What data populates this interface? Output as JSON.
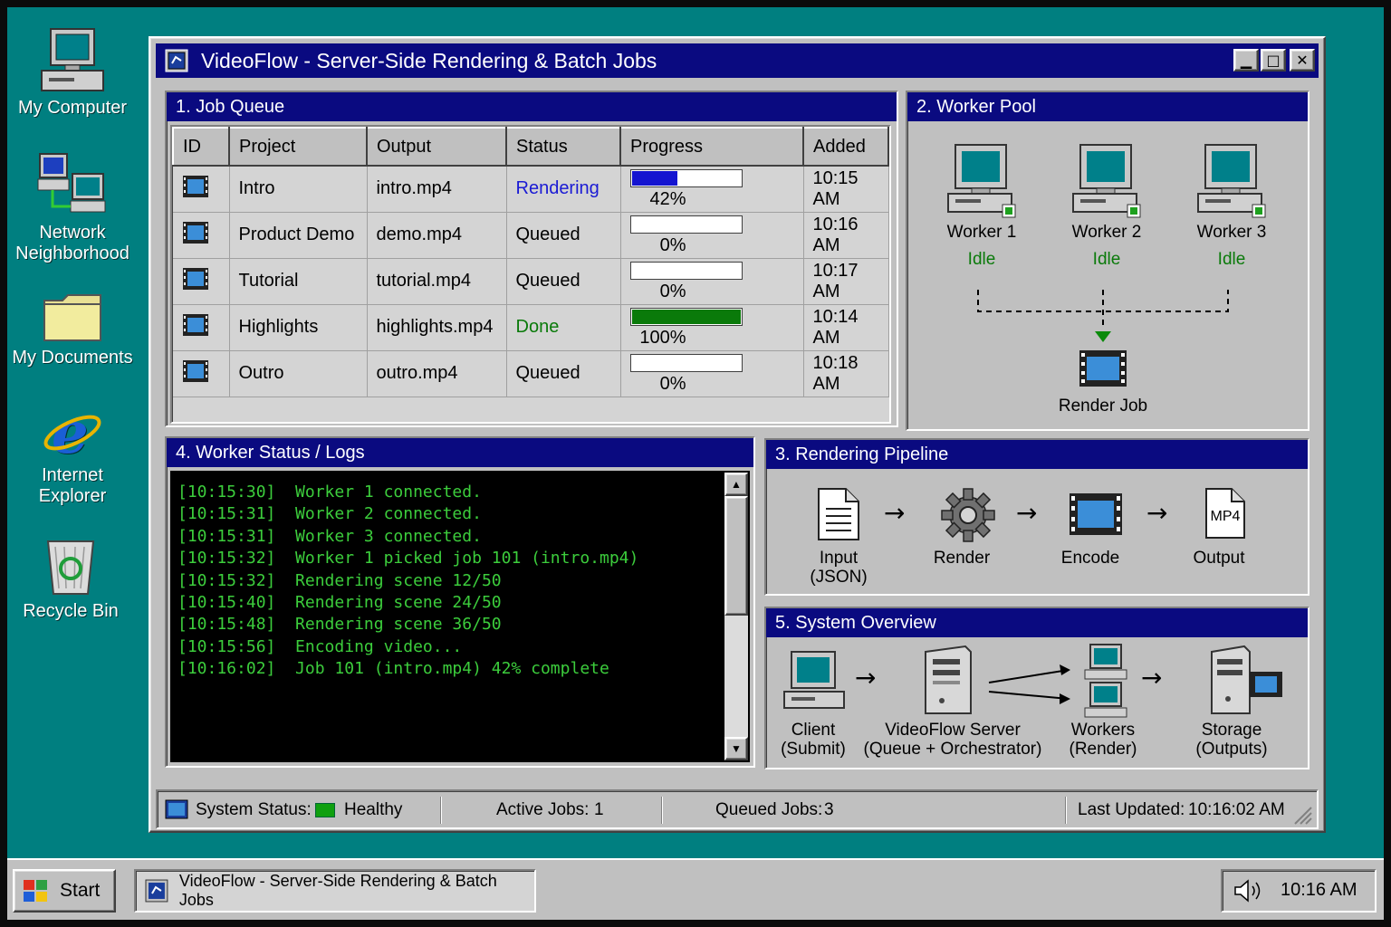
{
  "desktop": {
    "icons": [
      {
        "label": "My Computer",
        "icon": "computer-icon"
      },
      {
        "label": "Network Neighborhood",
        "icon": "network-icon"
      },
      {
        "label": "My Documents",
        "icon": "folder-icon"
      },
      {
        "label": "Internet Explorer",
        "icon": "ie-icon"
      },
      {
        "label": "Recycle Bin",
        "icon": "recycle-bin-icon"
      }
    ]
  },
  "window": {
    "title": "VideoFlow - Server-Side Rendering & Batch Jobs",
    "controls": {
      "minimize": "▁",
      "maximize": "□",
      "close": "✕"
    }
  },
  "job_queue": {
    "title": "1.  Job Queue",
    "columns": [
      "ID",
      "Project",
      "Output",
      "Status",
      "Progress",
      "Added"
    ],
    "rows": [
      {
        "project": "Intro",
        "output": "intro.mp4",
        "status": "Rendering",
        "progress": 42,
        "progress_label": "42%",
        "added": "10:15 AM",
        "status_color": "#1a1ad4",
        "bar_color": "#1414d0"
      },
      {
        "project": "Product Demo",
        "output": "demo.mp4",
        "status": "Queued",
        "progress": 0,
        "progress_label": "0%",
        "added": "10:16 AM",
        "status_color": "#000000",
        "bar_color": "#1414d0"
      },
      {
        "project": "Tutorial",
        "output": "tutorial.mp4",
        "status": "Queued",
        "progress": 0,
        "progress_label": "0%",
        "added": "10:17 AM",
        "status_color": "#000000",
        "bar_color": "#1414d0"
      },
      {
        "project": "Highlights",
        "output": "highlights.mp4",
        "status": "Done",
        "progress": 100,
        "progress_label": "100%",
        "added": "10:14 AM",
        "status_color": "#0a7a0a",
        "bar_color": "#0a7a0a"
      },
      {
        "project": "Outro",
        "output": "outro.mp4",
        "status": "Queued",
        "progress": 0,
        "progress_label": "0%",
        "added": "10:18 AM",
        "status_color": "#000000",
        "bar_color": "#1414d0"
      }
    ]
  },
  "worker_pool": {
    "title": "2. Worker Pool",
    "workers": [
      {
        "name": "Worker 1",
        "state": "Idle"
      },
      {
        "name": "Worker 2",
        "state": "Idle"
      },
      {
        "name": "Worker 3",
        "state": "Idle"
      }
    ],
    "target_label": "Render Job",
    "state_color": "#0a7a0a"
  },
  "logs": {
    "title": "4. Worker Status / Logs",
    "lines": [
      "[10:15:30]  Worker 1 connected.",
      "[10:15:31]  Worker 2 connected.",
      "[10:15:31]  Worker 3 connected.",
      "[10:15:32]  Worker 1 picked job 101 (intro.mp4)",
      "[10:15:32]  Rendering scene 12/50",
      "[10:15:40]  Rendering scene 24/50",
      "[10:15:48]  Rendering scene 36/50",
      "[10:15:56]  Encoding video...",
      "[10:16:02]  Job 101 (intro.mp4) 42% complete"
    ]
  },
  "pipeline": {
    "title": "3. Rendering Pipeline",
    "stages": [
      {
        "label": "Input\n(JSON)",
        "icon": "document-icon"
      },
      {
        "label": "Render",
        "icon": "gear-icon"
      },
      {
        "label": "Encode",
        "icon": "film-icon"
      },
      {
        "label": "Output",
        "icon": "mp4-file-icon",
        "badge": "MP4"
      }
    ],
    "arrow": "→"
  },
  "overview": {
    "title": "5. System Overview",
    "nodes": [
      {
        "label": "Client\n(Submit)",
        "icon": "computer-icon"
      },
      {
        "label": "VideoFlow Server\n(Queue + Orchestrator)",
        "icon": "server-icon"
      },
      {
        "label": "Workers\n(Render)",
        "icon": "workers-icon"
      },
      {
        "label": "Storage\n(Outputs)",
        "icon": "storage-icon"
      }
    ]
  },
  "statusbar": {
    "system_status_label": "System Status:",
    "system_status_value": "Healthy",
    "active_jobs_label": "Active Jobs:",
    "active_jobs_value": "1",
    "queued_jobs_label": "Queued Jobs:",
    "queued_jobs_value": "3",
    "last_updated_label": "Last Updated:",
    "last_updated_value": "10:16:02 AM",
    "healthy_color": "#0fa00f"
  },
  "taskbar": {
    "start_label": "Start",
    "task_label": "VideoFlow - Server-Side Rendering & Batch Jobs",
    "clock": "10:16 AM",
    "tray_icon": "speaker-icon"
  }
}
